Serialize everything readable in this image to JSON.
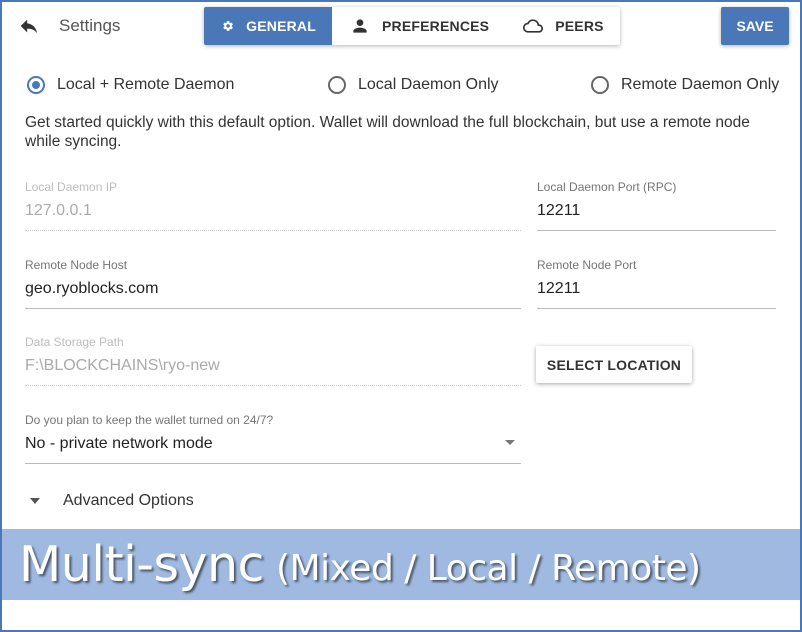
{
  "header": {
    "title": "Settings",
    "tabs": [
      {
        "label": "GENERAL",
        "icon": "gear-icon",
        "active": true
      },
      {
        "label": "PREFERENCES",
        "icon": "person-icon",
        "active": false
      },
      {
        "label": "PEERS",
        "icon": "cloud-icon",
        "active": false
      }
    ],
    "save_label": "SAVE"
  },
  "daemon_modes": [
    {
      "label": "Local + Remote Daemon",
      "selected": true
    },
    {
      "label": "Local Daemon Only",
      "selected": false
    },
    {
      "label": "Remote Daemon Only",
      "selected": false
    }
  ],
  "description": "Get started quickly with this default option. Wallet will download the full blockchain, but use a remote node while syncing.",
  "fields": {
    "local_ip": {
      "label": "Local Daemon IP",
      "value": "127.0.0.1",
      "disabled": true
    },
    "local_port": {
      "label": "Local Daemon Port (RPC)",
      "value": "12211",
      "disabled": false
    },
    "remote_host": {
      "label": "Remote Node Host",
      "value": "geo.ryoblocks.com",
      "disabled": false
    },
    "remote_port": {
      "label": "Remote Node Port",
      "value": "12211",
      "disabled": false
    },
    "data_path": {
      "label": "Data Storage Path",
      "value": "F:\\BLOCKCHAINS\\ryo-new",
      "disabled": true
    },
    "keep_on": {
      "label": "Do you plan to keep the wallet turned on 24/7?",
      "value": "No - private network mode"
    }
  },
  "select_location_label": "SELECT LOCATION",
  "advanced_label": "Advanced Options",
  "banner": {
    "main": "Multi-sync",
    "sub": "(Mixed / Local / Remote)"
  },
  "colors": {
    "accent": "#4a77b8",
    "banner": "#9fb9e0",
    "frame_border": "#4a77b8"
  }
}
